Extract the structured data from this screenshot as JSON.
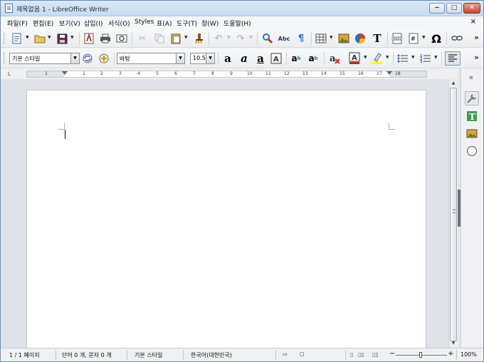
{
  "window": {
    "title": "제목없음 1 - LibreOffice Writer"
  },
  "colors": {
    "accent": "#2f6fb5",
    "chrome": "#f0f0f0",
    "canvas": "#dfe2e6",
    "page": "#ffffff",
    "close": "#c9472f"
  },
  "menubar": {
    "items": [
      "파일(F)",
      "편집(E)",
      "보기(V)",
      "삽입(I)",
      "서식(O)",
      "Styles",
      "표(A)",
      "도구(T)",
      "창(W)",
      "도움말(H)"
    ],
    "close_glyph": "×"
  },
  "toolbar1": {
    "icons": [
      "new-document-icon",
      "open-folder-icon",
      "save-icon",
      "export-pdf-icon",
      "print-icon",
      "print-preview-icon",
      "cut-icon",
      "copy-icon",
      "paste-icon",
      "clone-formatting-icon",
      "undo-icon",
      "redo-icon",
      "find-replace-icon",
      "spellcheck-icon",
      "formatting-marks-icon",
      "insert-table-icon",
      "insert-image-icon",
      "insert-chart-icon",
      "insert-textbox-icon",
      "page-break-icon",
      "insert-field-icon",
      "special-character-icon",
      "hyperlink-icon"
    ],
    "spellcheck_label": "Abc",
    "omega_label": "Ω",
    "overflow": "»"
  },
  "toolbar2": {
    "paragraph_style": "기본 스타일",
    "font_name": "바탕",
    "font_size": "10.5",
    "overflow": "»"
  },
  "ruler": {
    "corner": "L",
    "numbers": [
      "1",
      "1",
      "2",
      "3",
      "4",
      "5",
      "6",
      "7",
      "8",
      "9",
      "10",
      "11",
      "12",
      "13",
      "14",
      "15",
      "16",
      "17",
      "18"
    ]
  },
  "statusbar": {
    "page": "1 / 1 페이지",
    "word_count": "단어 0 개, 문자 0 개",
    "style": "기본 스타일",
    "language": "한국어(대한민국)",
    "zoom": "100%",
    "zoom_minus": "−",
    "zoom_plus": "+"
  },
  "sidebar": {
    "menu_glyph": "≡",
    "icons": [
      "properties-icon",
      "styles-icon",
      "gallery-icon",
      "navigator-icon"
    ]
  }
}
